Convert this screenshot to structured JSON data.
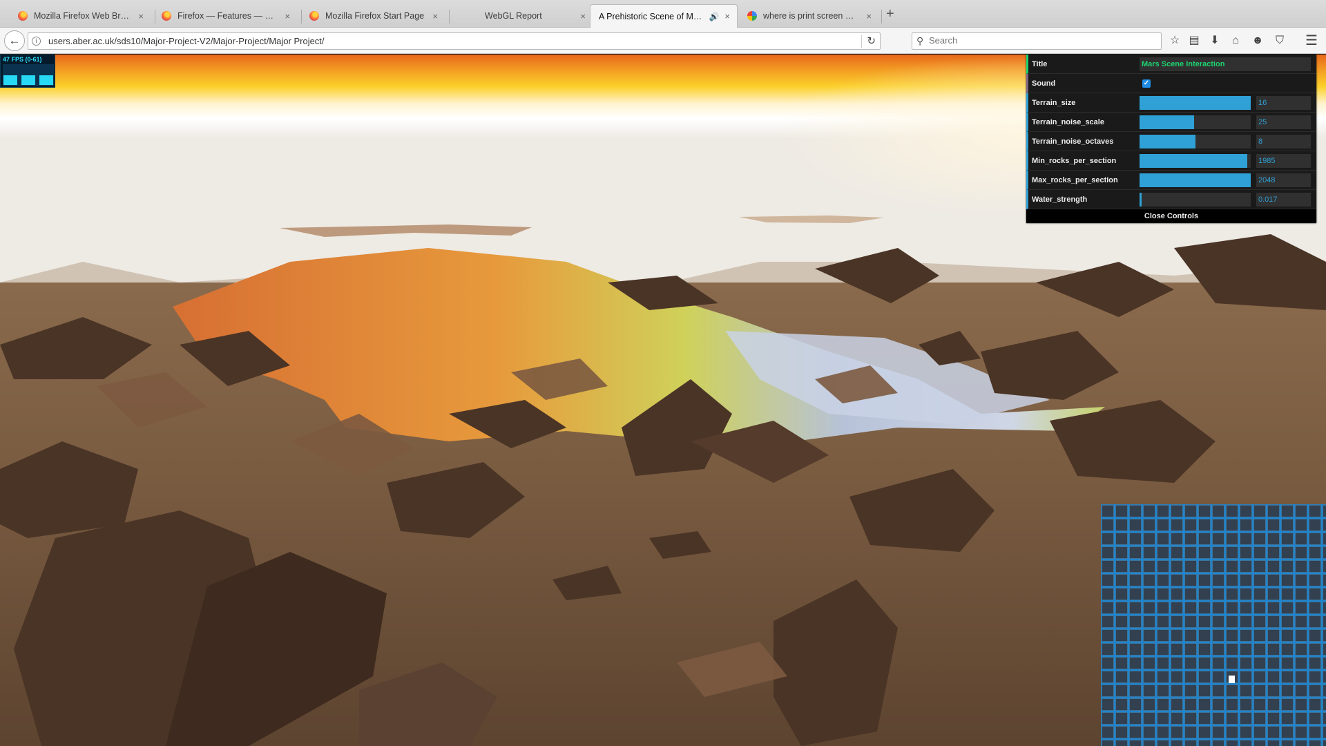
{
  "browser": {
    "tabs": [
      {
        "label": "Mozilla Firefox Web Brows…",
        "icon": "firefox-icon",
        "active": false
      },
      {
        "label": "Firefox — Features — Mozilla",
        "icon": "firefox-icon",
        "active": false
      },
      {
        "label": "Mozilla Firefox Start Page",
        "icon": "firefox-icon",
        "active": false
      },
      {
        "label": "WebGL Report",
        "icon": "",
        "active": false
      },
      {
        "label": "A Prehistoric Scene of Mars…",
        "icon": "",
        "active": true
      },
      {
        "label": "where is print screen mac k…",
        "icon": "google-icon",
        "active": false
      }
    ],
    "close_glyph": "×",
    "new_tab_glyph": "+",
    "url": "users.aber.ac.uk/sds10/Major-Project-V2/Major-Project/Major Project/",
    "search_placeholder": "Search",
    "icons": {
      "back": "←",
      "info": "i",
      "reload": "↻",
      "search": "⚲",
      "bookmark_star": "☆",
      "reading_list": "▤",
      "download": "⬇",
      "home": "⌂",
      "chat": "☻",
      "pocket": "⛉",
      "menu": "☰",
      "speaker": "🔊"
    }
  },
  "fps_meter": {
    "text": "47 FPS (0-61)",
    "bar_levels": [
      0.8,
      0.8,
      0.8
    ]
  },
  "gui": {
    "title_label": "Title",
    "title_value": "Mars Scene Interaction",
    "sound_label": "Sound",
    "sound_checked": true,
    "check_glyph": "✓",
    "params": [
      {
        "label": "Terrain_size",
        "value": "16",
        "fill": 1.0
      },
      {
        "label": "Terrain_noise_scale",
        "value": "25",
        "fill": 0.49
      },
      {
        "label": "Terrain_noise_octaves",
        "value": "8",
        "fill": 0.5
      },
      {
        "label": "Min_rocks_per_section",
        "value": "1985",
        "fill": 0.97
      },
      {
        "label": "Max_rocks_per_section",
        "value": "2048",
        "fill": 1.0
      },
      {
        "label": "Water_strength",
        "value": "0.017",
        "fill": 0.02
      }
    ],
    "close_label": "Close Controls"
  },
  "colors": {
    "gui_accent_string": "#1ed36f",
    "gui_accent_number": "#2fa1d6",
    "fps_cyan": "#2de1ff"
  }
}
